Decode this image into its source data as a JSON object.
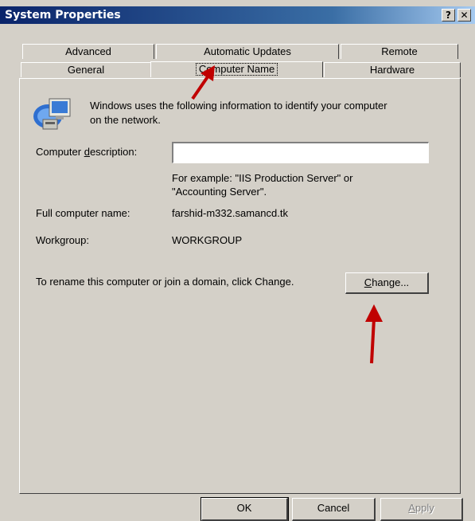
{
  "window": {
    "title": "System Properties",
    "help_button": "?",
    "close_button": "✕"
  },
  "tabs": {
    "row_back": [
      "Advanced",
      "Automatic Updates",
      "Remote"
    ],
    "row_front": [
      "General",
      "Computer Name",
      "Hardware"
    ],
    "active": "Computer Name"
  },
  "panel": {
    "info_line1": "Windows uses the following information to identify your computer",
    "info_line2": "on the network.",
    "description_label_pre": "Computer ",
    "description_label_u": "d",
    "description_label_post": "escription:",
    "description_value": "",
    "example_line1": "For example: \"IIS Production Server\" or",
    "example_line2": "\"Accounting Server\".",
    "full_name_label": "Full computer name:",
    "full_name_value": "farshid-m332.samancd.tk",
    "workgroup_label": "Workgroup:",
    "workgroup_value": "WORKGROUP",
    "rename_text": "To rename this computer or join a domain, click Change.",
    "change_button_u": "C",
    "change_button_rest": "hange..."
  },
  "footer": {
    "ok_label": "OK",
    "cancel_label": "Cancel",
    "apply_u": "A",
    "apply_rest": "pply"
  },
  "annotation_color": "#c00000"
}
